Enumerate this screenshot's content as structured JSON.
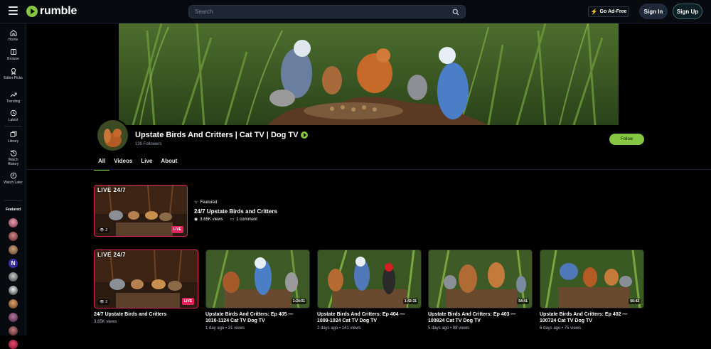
{
  "header": {
    "logo_text": "rumble",
    "search_placeholder": "Search",
    "ad_free_label": "Go Ad-Free",
    "sign_in_label": "Sign In",
    "sign_up_label": "Sign Up"
  },
  "sidebar": {
    "items": [
      {
        "label": "Home",
        "icon": "home-icon"
      },
      {
        "label": "Browse",
        "icon": "browse-icon"
      },
      {
        "label": "Editor Picks",
        "icon": "award-icon"
      },
      {
        "label": "Trending",
        "icon": "trending-icon"
      },
      {
        "label": "Latest",
        "icon": "clock-icon"
      },
      {
        "label": "Library",
        "icon": "library-icon"
      },
      {
        "label": "Watch History",
        "icon": "history-icon"
      },
      {
        "label": "Watch Later",
        "icon": "watch-later-icon"
      }
    ],
    "featured_heading": "Featured"
  },
  "channel": {
    "title": "Upstate Birds And Critters | Cat TV | Dog TV",
    "followers": "130 Followers",
    "follow_label": "Follow"
  },
  "tabs": [
    "All",
    "Videos",
    "Live",
    "About"
  ],
  "featured": {
    "label": "Featured",
    "live_tag": "LIVE 24/7",
    "watchers": "2",
    "live_badge": "LIVE",
    "title": "24/7 Upstate Birds and Critters",
    "views": "3.65K views",
    "comments": "1 comment"
  },
  "videos": [
    {
      "title_1": "24/7 Upstate Birds and Critters",
      "title_2": "",
      "meta": "3.65K views",
      "live_tag": "LIVE 24/7",
      "watchers": "2",
      "live_badge": "LIVE",
      "duration": ""
    },
    {
      "title_1": "Upstate Birds And Critters: Ep 405 —",
      "title_2": "1010-1124 Cat TV Dog TV",
      "meta": "1 day ago • 31 views",
      "duration": "1:24:51"
    },
    {
      "title_1": "Upstate Birds And Critters: Ep 404 —",
      "title_2": "1009-1024 Cat TV Dog TV",
      "meta": "2 days ago • 141 views",
      "duration": "1:42:31"
    },
    {
      "title_1": "Upstate Birds And Critters: Ep 403 —",
      "title_2": "100824 Cat TV Dog TV",
      "meta": "5 days ago • 98 views",
      "duration": "54:41"
    },
    {
      "title_1": "Upstate Birds And Critters: Ep 402 —",
      "title_2": "100724 Cat TV Dog TV",
      "meta": "6 days ago • 75 views",
      "duration": "56:42"
    }
  ],
  "colors": {
    "accent": "#85c742",
    "live": "#e0245e",
    "background": "#000000"
  }
}
